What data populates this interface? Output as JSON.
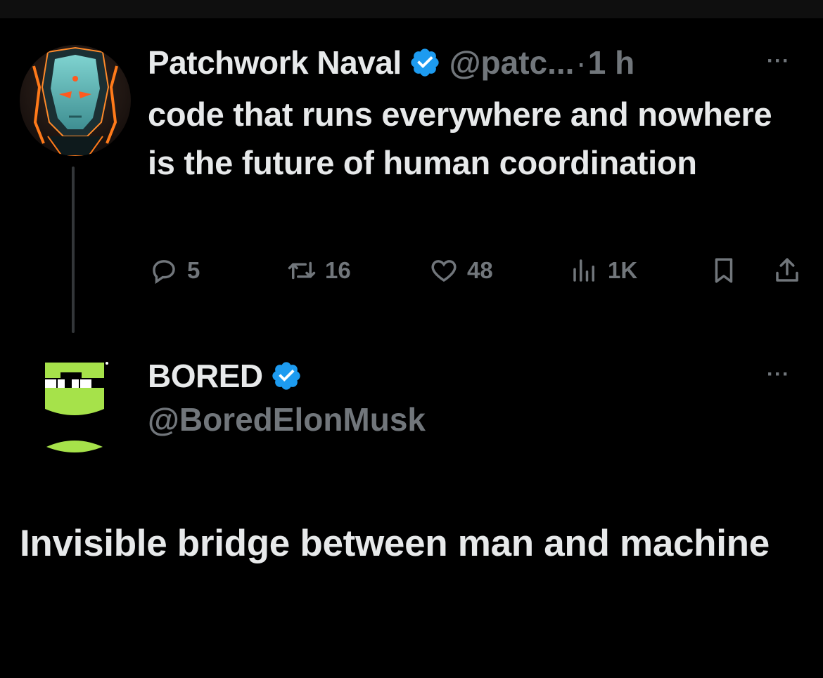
{
  "tweet1": {
    "display_name": "Patchwork Naval",
    "handle": "@patc...",
    "separator": "·",
    "time": "1 h",
    "text": "code that runs everywhere and nowhere is the future of human coordination",
    "stats": {
      "replies": "5",
      "reposts": "16",
      "likes": "48",
      "views": "1K"
    }
  },
  "tweet2": {
    "display_name": "BORED",
    "handle": "@BoredElonMusk",
    "text": "Invisible bridge between man and machine"
  },
  "more_label": "···",
  "colors": {
    "background": "#000000",
    "text": "#e7e9ea",
    "muted": "#71767b",
    "verified": "#1d9bf0",
    "bored_green": "#a6e24a"
  },
  "icons": [
    "verified-badge-icon",
    "reply-icon",
    "repost-icon",
    "like-icon",
    "views-icon",
    "bookmark-icon",
    "share-icon",
    "more-icon"
  ]
}
